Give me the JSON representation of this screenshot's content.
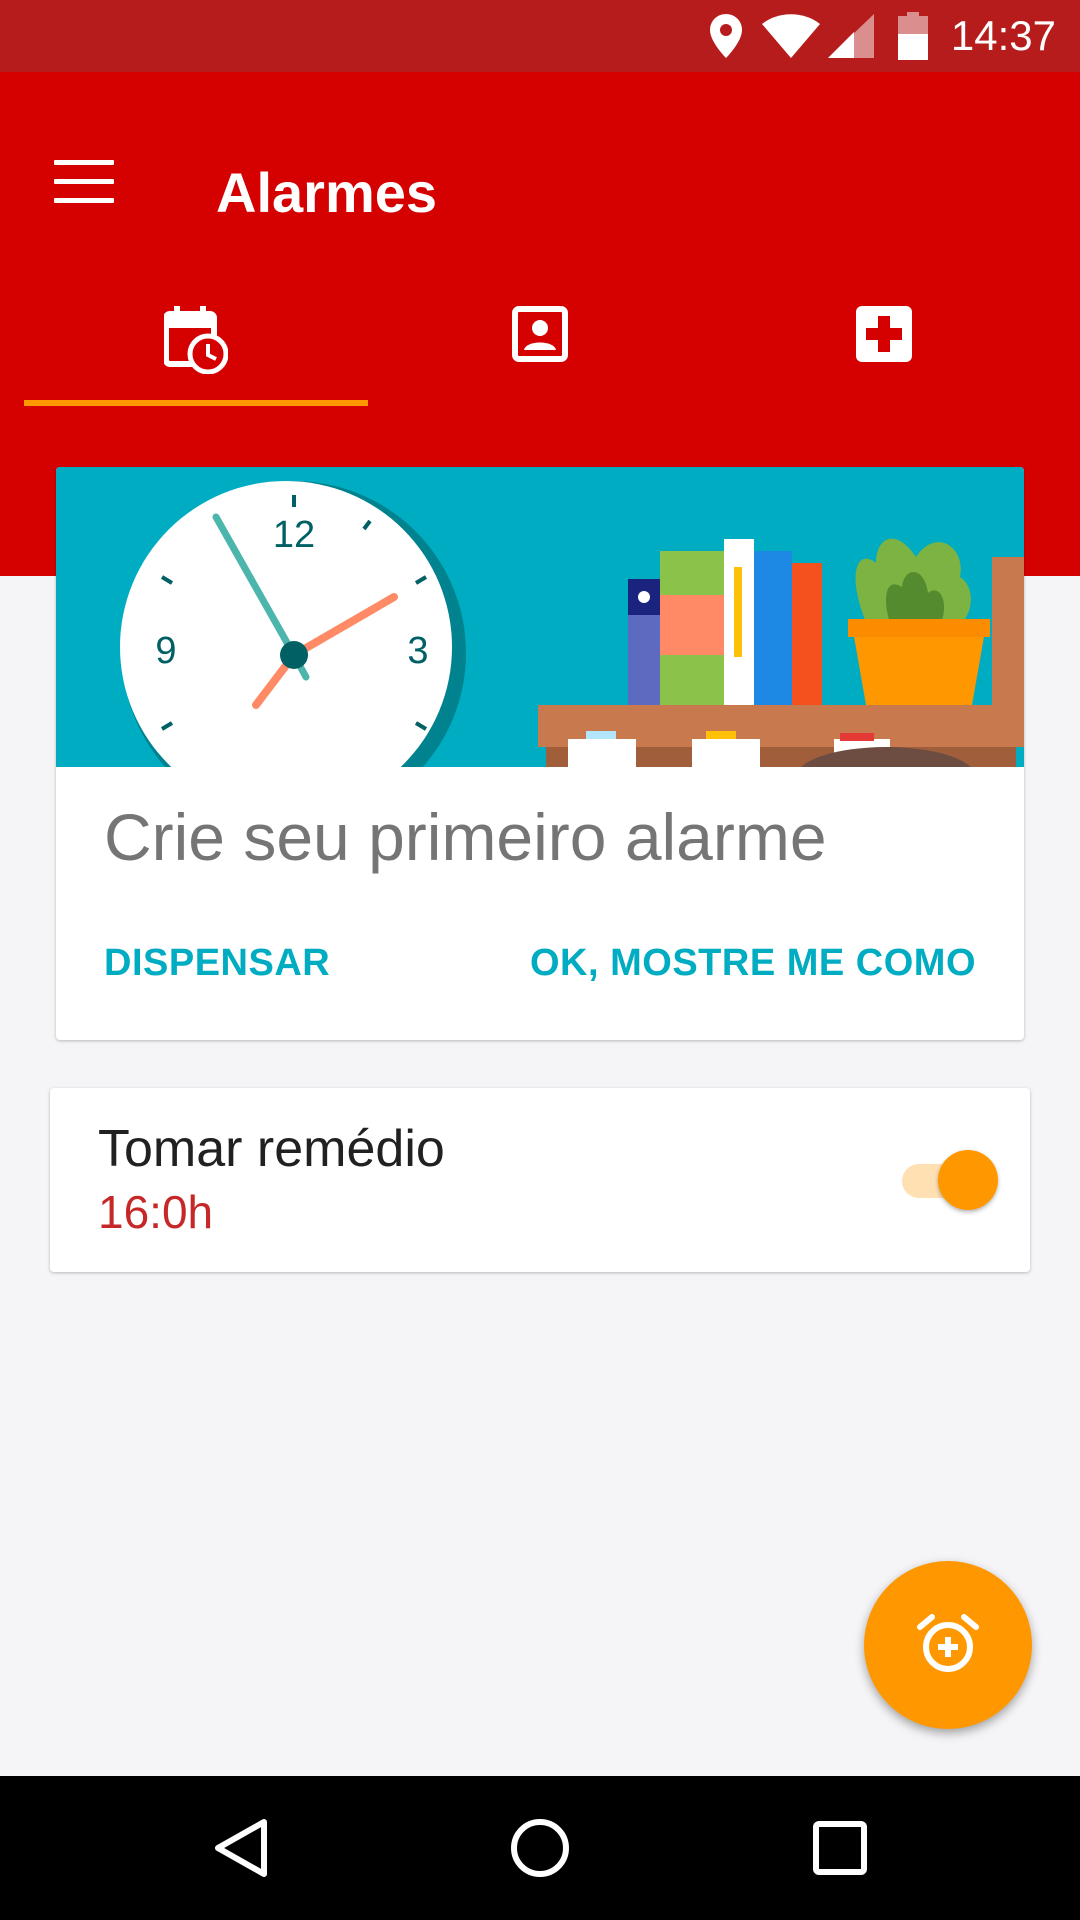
{
  "status_bar": {
    "time": "14:37",
    "icons": [
      "location-icon",
      "wifi-icon",
      "signal-icon",
      "battery-icon"
    ]
  },
  "app_bar": {
    "title": "Alarmes",
    "menu_icon": "menu-icon",
    "background_color": "#d50000"
  },
  "tabs": [
    {
      "icon": "calendar-clock-icon",
      "selected": true
    },
    {
      "icon": "contact-card-icon",
      "selected": false
    },
    {
      "icon": "medical-cross-icon",
      "selected": false
    }
  ],
  "onboarding_card": {
    "title": "Crie seu primeiro alarme",
    "dismiss_label": "DISPENSAR",
    "confirm_label": "OK, MOSTRE ME COMO",
    "clock_numbers": {
      "twelve": "12",
      "nine": "9",
      "three": "3"
    }
  },
  "alarms": [
    {
      "name": "Tomar remédio",
      "time": "16:0h",
      "enabled": true
    }
  ],
  "fab": {
    "icon": "add-alarm-icon",
    "color": "#ff9800"
  },
  "colors": {
    "accent": "#ff9800",
    "link": "#00acc1",
    "alarm_time": "#c62828",
    "status_bar": "#b71c1c"
  }
}
